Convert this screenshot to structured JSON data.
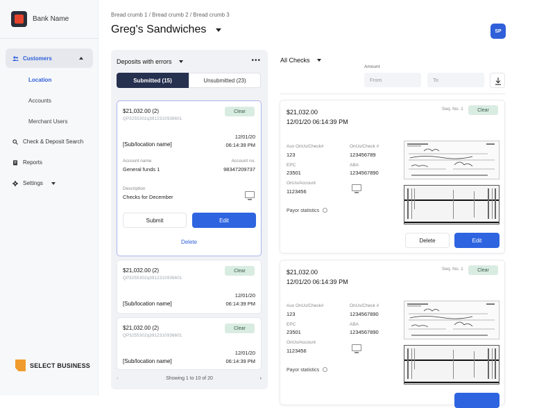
{
  "app": {
    "bank_name": "Bank Name",
    "avatar_initials": "SP",
    "brand_footer": "SELECT BUSINESS"
  },
  "sidebar": {
    "customers": "Customers",
    "sub": [
      "Location",
      "Accounts",
      "Merchant Users"
    ],
    "items": [
      "Check & Deposit Search",
      "Reports",
      "Settings"
    ]
  },
  "header": {
    "breadcrumb": "Bread crumb 1 / Bread crumb 2 / Bread crumb 3",
    "title": "Greg's Sandwiches"
  },
  "left": {
    "heading": "Deposits with errors",
    "more": "•••",
    "tab_submitted": "Submitted (15)",
    "tab_unsubmitted": "Unsubmitted (23)",
    "cards": [
      {
        "amount": "$21,032.00 (2)",
        "code": "QP3255302q3912310936601",
        "status": "Clear",
        "date": "12/01/20",
        "time": "06:14:39 PM",
        "location": "[Sub/location name]",
        "account_name_label": "Account name",
        "account_name": "General funds 1",
        "account_no_label": "Account no.",
        "account_no": "98347209737",
        "description_label": "Description",
        "description": "Checks for December",
        "submit": "Submit",
        "edit": "Edit",
        "delete": "Delete"
      },
      {
        "amount": "$21,032.00 (2)",
        "code": "QP3255302q3912310936601",
        "status": "Clear",
        "date": "12/01/20",
        "time": "06:14:39 PM",
        "location": "[Sub/location name]"
      },
      {
        "amount": "$21,032.00 (2)",
        "code": "QP3255302q3912310936601",
        "status": "Clear",
        "date": "12/01/20",
        "time": "06:14:39 PM",
        "location": "[Sub/location name]"
      }
    ],
    "pager": "Showing 1 to 10 of 20"
  },
  "right": {
    "heading": "All Checks",
    "amount_label": "Amount",
    "from_placeholder": "From",
    "to_placeholder": "To",
    "checks": [
      {
        "amount": "$21,032.00",
        "datetime": "12/01/20  06:14:39 PM",
        "seq": "Seq. No. 1",
        "status": "Clear",
        "aux_label": "Aux OnUs/Check#",
        "aux": "123",
        "onus_label": "OnUs/Check #",
        "onus": "123456789",
        "epc_label": "EPC",
        "epc": "23501",
        "aba_label": "ABA",
        "aba": "1234567890",
        "onus_account_label": "OnUs/Account",
        "onus_account": "1123456",
        "payor": "Payor statistics",
        "delete": "Delete",
        "edit": "Edit"
      },
      {
        "amount": "$21,032.00",
        "datetime": "12/01/20  06:14:39 PM",
        "seq": "Seq. No. 1",
        "status": "Clear",
        "aux_label": "Aux OnUs/Check#",
        "aux": "123",
        "onus_label": "OnUs/Check #",
        "onus": "1234567890",
        "epc_label": "EPC",
        "epc": "23501",
        "aba_label": "ABA",
        "aba": "1234567890",
        "onus_account_label": "OnUs/Account",
        "onus_account": "1123456",
        "payor": "Payor statistics"
      }
    ]
  }
}
